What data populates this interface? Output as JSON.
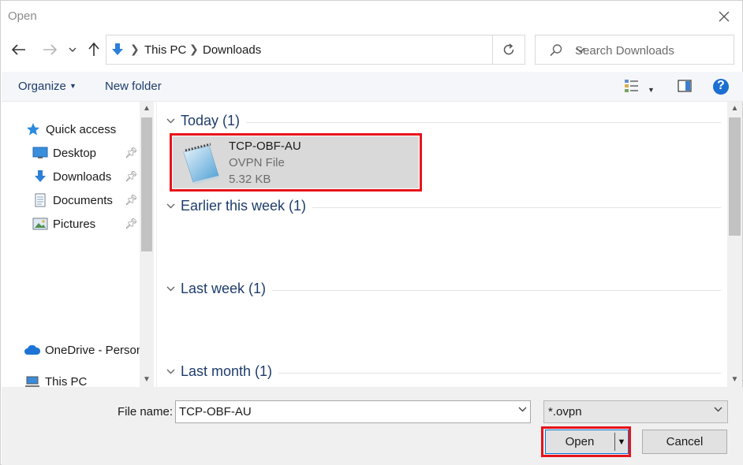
{
  "window": {
    "title": "Open"
  },
  "address": {
    "crumbs": [
      "This PC",
      "Downloads"
    ]
  },
  "search": {
    "placeholder": "Search Downloads"
  },
  "toolbar": {
    "organize_label": "Organize",
    "new_folder_label": "New folder",
    "help_label": "?"
  },
  "nav": {
    "items": [
      {
        "label": "Quick access",
        "icon": "star-icon"
      },
      {
        "label": "Desktop",
        "icon": "desktop-icon",
        "pinned": true
      },
      {
        "label": "Downloads",
        "icon": "download-arrow-icon",
        "pinned": true
      },
      {
        "label": "Documents",
        "icon": "document-icon",
        "pinned": true
      },
      {
        "label": "Pictures",
        "icon": "pictures-icon",
        "pinned": true
      },
      {
        "label": "OneDrive - Person",
        "icon": "cloud-icon"
      },
      {
        "label": "This PC",
        "icon": "computer-icon"
      }
    ]
  },
  "content": {
    "groups": [
      {
        "label": "Today (1)"
      },
      {
        "label": "Earlier this week (1)"
      },
      {
        "label": "Last week (1)"
      },
      {
        "label": "Last month (1)"
      }
    ],
    "file": {
      "name": "TCP-OBF-AU",
      "type": "OVPN File",
      "size": "5.32 KB",
      "icon": "notepad-icon"
    }
  },
  "bottom": {
    "filename_label": "File name:",
    "filename_value": "TCP-OBF-AU",
    "filter_value": "*.ovpn",
    "open_label": "Open",
    "cancel_label": "Cancel"
  },
  "colors": {
    "highlight": "#e8131a",
    "accent": "#0078d7",
    "group_text": "#1e3c6b"
  }
}
